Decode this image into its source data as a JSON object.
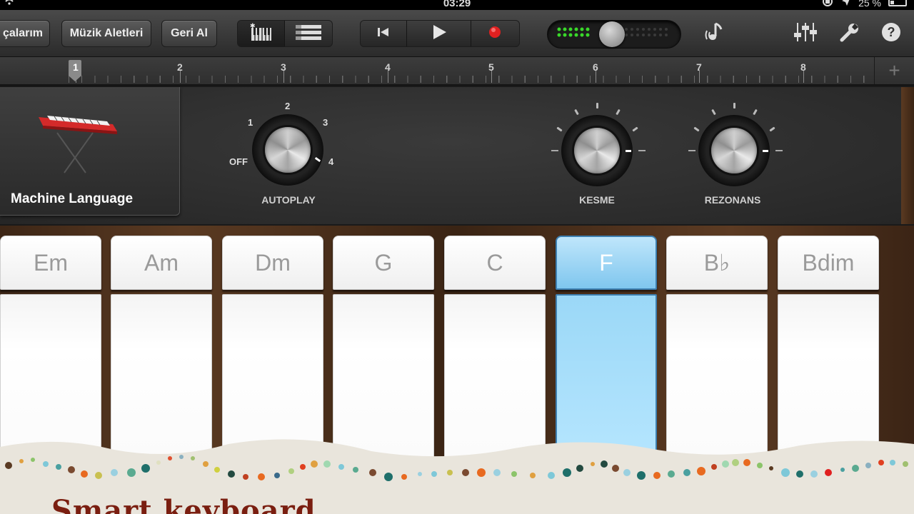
{
  "status": {
    "time": "03:29",
    "battery": "25 %"
  },
  "toolbar": {
    "my_songs": "çalarım",
    "instruments": "Müzik Aletleri",
    "undo": "Geri Al"
  },
  "ruler": {
    "bars": [
      "1",
      "2",
      "3",
      "4",
      "5",
      "6",
      "7",
      "8"
    ],
    "add": "+"
  },
  "instrument": {
    "name": "Machine Language"
  },
  "autoplay": {
    "label": "AUTOPLAY",
    "off": "OFF",
    "m1": "1",
    "m2": "2",
    "m3": "3",
    "m4": "4",
    "value": "4"
  },
  "cutoff": {
    "label": "KESME"
  },
  "resonance": {
    "label": "REZONANS"
  },
  "chords": [
    "Em",
    "Am",
    "Dm",
    "G",
    "C",
    "F",
    "B♭",
    "Bdim"
  ],
  "active_chord": "F",
  "footer": {
    "title": "Smart keyboard"
  },
  "colors": {
    "active_chord": "#7fc6ee",
    "record": "#e02020",
    "level_led": "#39d82a",
    "title": "#7a1e10"
  }
}
